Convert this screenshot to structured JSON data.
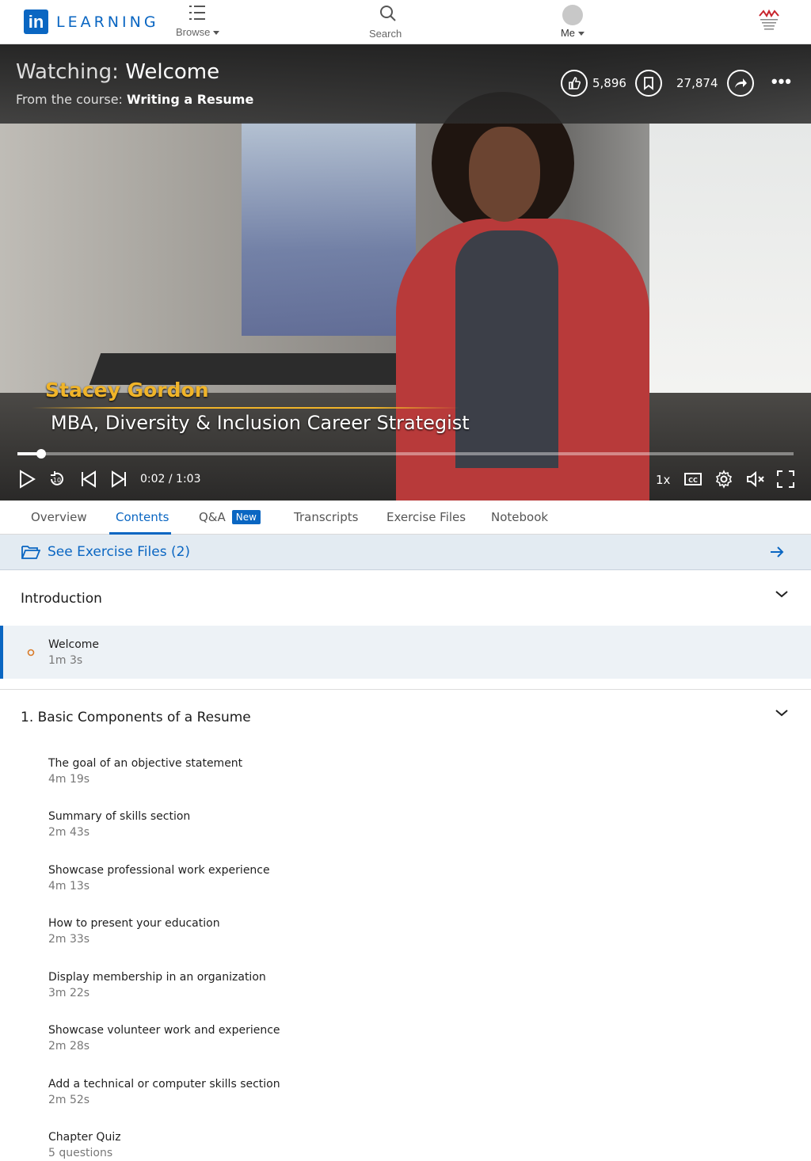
{
  "colors": {
    "brand": "#0a66c2",
    "accent_gold": "#f0b429",
    "current_bg": "#edf2f6"
  },
  "header": {
    "logo_mark": "in",
    "logo_text": "LEARNING",
    "browse_label": "Browse",
    "search_label": "Search",
    "me_label": "Me",
    "org_logo_icon": "australian-institute-of-business-logo"
  },
  "video": {
    "watching_prefix": "Watching:",
    "watching_title": "Welcome",
    "course_prefix": "From the course:",
    "course_title": "Writing a Resume",
    "likes": "5,896",
    "saves": "27,874",
    "presenter_name": "Stacey Gordon",
    "presenter_role": "MBA, Diversity & Inclusion Career Strategist",
    "timecode": "0:02 / 1:03",
    "progress_fraction": 0.031,
    "speed": "1x"
  },
  "tabs": [
    {
      "label": "Overview"
    },
    {
      "label": "Contents"
    },
    {
      "label": "Q&A",
      "badge": "New"
    },
    {
      "label": "Transcripts"
    },
    {
      "label": "Exercise Files"
    },
    {
      "label": "Notebook"
    }
  ],
  "exercise_files": {
    "label": "See Exercise Files (2)"
  },
  "sections": [
    {
      "title": "Introduction",
      "items": [
        {
          "title": "Welcome",
          "meta": "1m 3s"
        }
      ]
    },
    {
      "title": "1. Basic Components of a Resume",
      "items": [
        {
          "title": "The goal of an objective statement",
          "meta": "4m 19s"
        },
        {
          "title": "Summary of skills section",
          "meta": "2m 43s"
        },
        {
          "title": "Showcase professional work experience",
          "meta": "4m 13s"
        },
        {
          "title": "How to present your education",
          "meta": "2m 33s"
        },
        {
          "title": "Display membership in an organization",
          "meta": "3m 22s"
        },
        {
          "title": "Showcase volunteer work and experience",
          "meta": "2m 28s"
        },
        {
          "title": "Add a technical or computer skills section",
          "meta": "2m 52s"
        },
        {
          "title": "Chapter Quiz",
          "meta": "5 questions"
        }
      ]
    }
  ]
}
